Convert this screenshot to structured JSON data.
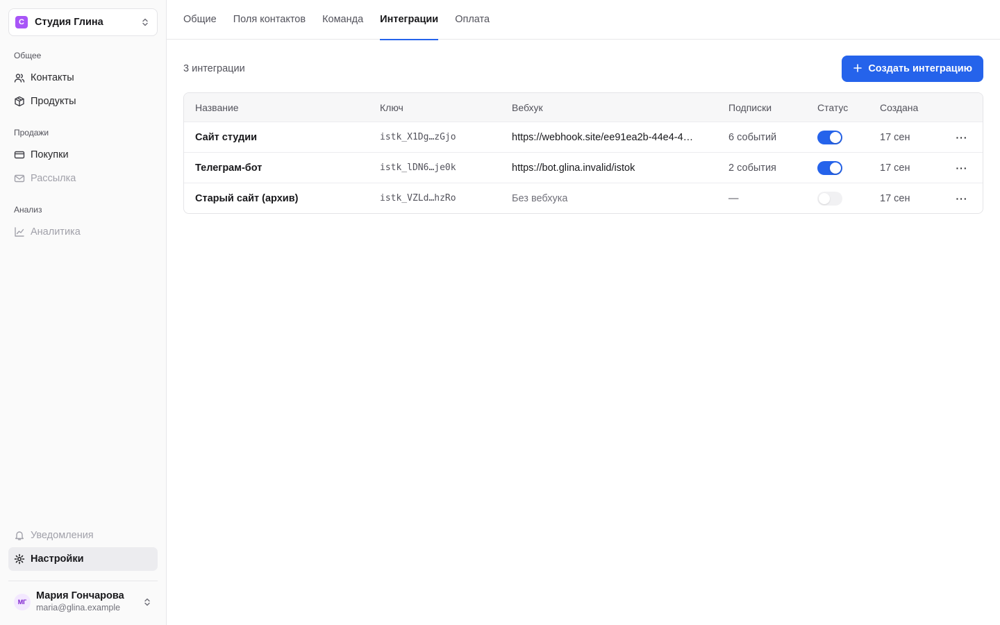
{
  "workspace": {
    "logo_letter": "С",
    "name": "Студия Глина"
  },
  "sidebar": {
    "sections": [
      {
        "heading": "Общее",
        "items": [
          {
            "label": "Контакты",
            "icon": "users-icon"
          },
          {
            "label": "Продукты",
            "icon": "package-icon"
          }
        ]
      },
      {
        "heading": "Продажи",
        "items": [
          {
            "label": "Покупки",
            "icon": "credit-card-icon"
          },
          {
            "label": "Рассылка",
            "icon": "mail-icon"
          }
        ]
      },
      {
        "heading": "Анализ",
        "items": [
          {
            "label": "Аналитика",
            "icon": "chart-line-icon"
          }
        ]
      }
    ],
    "notifications_label": "Уведомления",
    "settings_label": "Настройки"
  },
  "user": {
    "initials": "МГ",
    "name": "Мария Гончарова",
    "email": "maria@glina.example"
  },
  "tabs": [
    "Общие",
    "Поля контактов",
    "Команда",
    "Интеграции",
    "Оплата"
  ],
  "active_tab": "Интеграции",
  "main": {
    "count_label": "3 интеграции",
    "create_button_label": "Создать интеграцию"
  },
  "table": {
    "columns": [
      "Название",
      "Ключ",
      "Вебхук",
      "Подписки",
      "Статус",
      "Создана"
    ],
    "rows": [
      {
        "name": "Сайт студии",
        "key": "istk_X1Dg…zGjo",
        "webhook": "https://webhook.site/ee91ea2b-44e4-4…",
        "subscriptions": "6 событий",
        "enabled": true,
        "created": "17 сен"
      },
      {
        "name": "Телеграм-бот",
        "key": "istk_lDN6…je0k",
        "webhook": "https://bot.glina.invalid/istok",
        "subscriptions": "2 события",
        "enabled": true,
        "created": "17 сен"
      },
      {
        "name": "Старый сайт (архив)",
        "key": "istk_VZLd…hzRo",
        "webhook": "Без вебхука",
        "subscriptions": "—",
        "enabled": false,
        "created": "17 сен"
      }
    ],
    "more_glyph": "···"
  },
  "colors": {
    "accent": "#2563eb",
    "workspace_logo": "#a855f7"
  }
}
